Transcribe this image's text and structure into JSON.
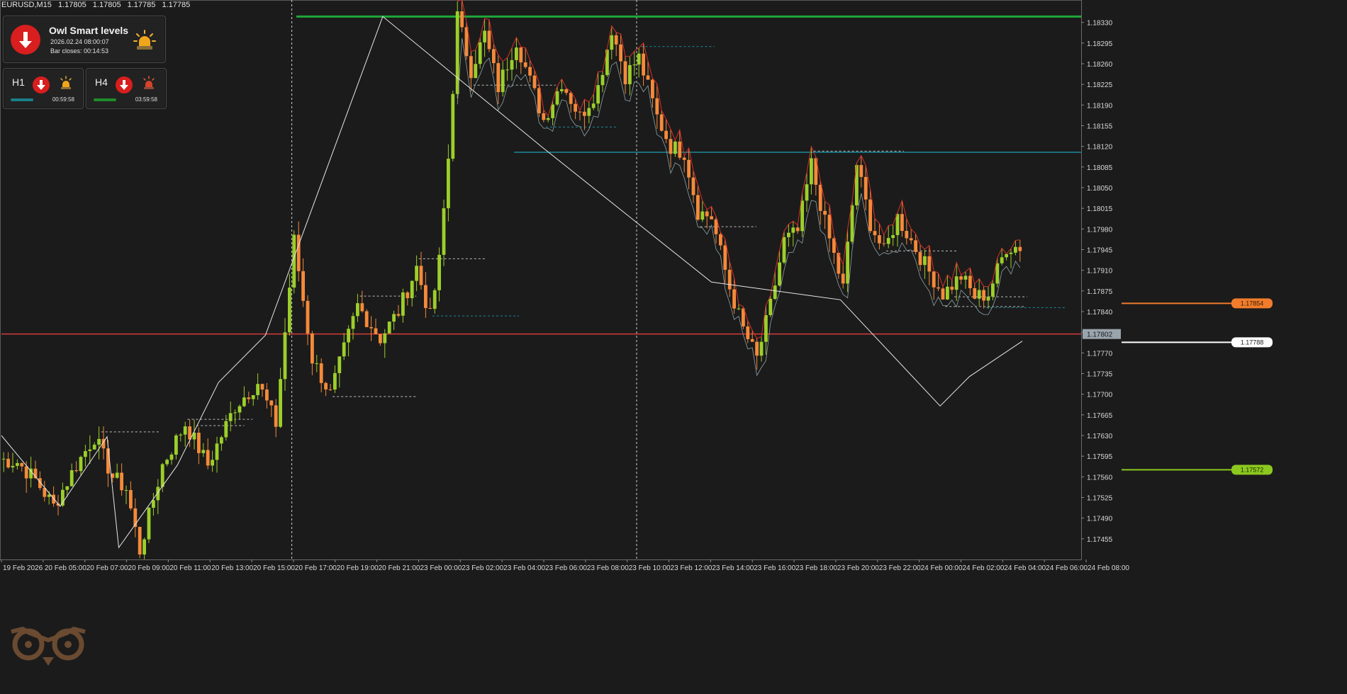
{
  "header": {
    "symbol": "EURUSD,M15",
    "open": "1.17805",
    "high": "1.17805",
    "low": "1.17785",
    "close": "1.17785"
  },
  "panel_main": {
    "title": "Owl Smart levels",
    "timestamp": "2026.02.24 08:00:07",
    "bar_close": "Bar closes: 00:14:53",
    "direction_icon": "arrow-down-icon",
    "alert_icon": "siren-icon"
  },
  "panel_h1": {
    "timeframe": "H1",
    "time": "00:59:58",
    "bar_color": "#1a7e86",
    "direction_icon": "arrow-down-icon"
  },
  "panel_h4": {
    "timeframe": "H4",
    "time": "03:59:58",
    "bar_color": "#1f8c2a",
    "direction_icon": "arrow-down-icon"
  },
  "colors": {
    "background": "#1b1b1b",
    "bull": "#9ccf2a",
    "bear": "#f58a3a",
    "red_line": "#d83a3a",
    "green_level": "#1ea83a",
    "teal_level": "#1a8a9a",
    "orange_tag": "#f07c2c",
    "white_tag": "#ffffff",
    "green_tag": "#8cc81f",
    "current_tag": "#9aa4ad"
  },
  "chart_data": {
    "type": "candlestick",
    "ylim": [
      1.1742,
      1.18368
    ],
    "y_ticks": [
      "1.18330",
      "1.18295",
      "1.18260",
      "1.18225",
      "1.18190",
      "1.18155",
      "1.18120",
      "1.18085",
      "1.18050",
      "1.18015",
      "1.17980",
      "1.17945",
      "1.17910",
      "1.17875",
      "1.17840",
      "1.17805",
      "1.17770",
      "1.17735",
      "1.17700",
      "1.17665",
      "1.17630",
      "1.17595",
      "1.17560",
      "1.17525",
      "1.17490",
      "1.17455"
    ],
    "x_labels": [
      "19 Feb 2026",
      "20 Feb 05:00",
      "20 Feb 07:00",
      "20 Feb 09:00",
      "20 Feb 11:00",
      "20 Feb 13:00",
      "20 Feb 15:00",
      "20 Feb 17:00",
      "20 Feb 19:00",
      "20 Feb 21:00",
      "23 Feb 00:00",
      "23 Feb 02:00",
      "23 Feb 04:00",
      "23 Feb 06:00",
      "23 Feb 08:00",
      "23 Feb 10:00",
      "23 Feb 12:00",
      "23 Feb 14:00",
      "23 Feb 16:00",
      "23 Feb 18:00",
      "23 Feb 20:00",
      "23 Feb 22:00",
      "24 Feb 00:00",
      "24 Feb 02:00",
      "24 Feb 04:00",
      "24 Feb 06:00",
      "24 Feb 08:00"
    ],
    "bar_count": 225,
    "anchors": [
      [
        0,
        1.1759
      ],
      [
        4,
        1.17585
      ],
      [
        8,
        1.17555
      ],
      [
        12,
        1.1751
      ],
      [
        17,
        1.1758
      ],
      [
        21,
        1.17628
      ],
      [
        25,
        1.1756
      ],
      [
        28,
        1.1754
      ],
      [
        31,
        1.17435
      ],
      [
        36,
        1.1758
      ],
      [
        41,
        1.1765
      ],
      [
        46,
        1.1758
      ],
      [
        52,
        1.1768
      ],
      [
        57,
        1.1772
      ],
      [
        61,
        1.1765
      ],
      [
        65,
        1.1796
      ],
      [
        69,
        1.1776
      ],
      [
        73,
        1.177
      ],
      [
        79,
        1.1785
      ],
      [
        84,
        1.17795
      ],
      [
        88,
        1.1784
      ],
      [
        92,
        1.17915
      ],
      [
        95,
        1.1783
      ],
      [
        97,
        1.17925
      ],
      [
        99,
        1.181
      ],
      [
        101,
        1.1834
      ],
      [
        104,
        1.1825
      ],
      [
        107,
        1.1831
      ],
      [
        110,
        1.1822
      ],
      [
        114,
        1.183
      ],
      [
        117,
        1.1823
      ],
      [
        120,
        1.18165
      ],
      [
        124,
        1.1823
      ],
      [
        128,
        1.1817
      ],
      [
        132,
        1.1822
      ],
      [
        135,
        1.1832
      ],
      [
        138,
        1.1824
      ],
      [
        141,
        1.1827
      ],
      [
        145,
        1.1817
      ],
      [
        148,
        1.1812
      ],
      [
        151,
        1.1811
      ],
      [
        154,
        1.1801
      ],
      [
        157,
        1.18
      ],
      [
        161,
        1.1788
      ],
      [
        164,
        1.1781
      ],
      [
        167,
        1.1776
      ],
      [
        170,
        1.1785
      ],
      [
        173,
        1.1796
      ],
      [
        176,
        1.17975
      ],
      [
        179,
        1.1809
      ],
      [
        182,
        1.1799
      ],
      [
        186,
        1.1788
      ],
      [
        189,
        1.1809
      ],
      [
        192,
        1.1799
      ],
      [
        195,
        1.1794
      ],
      [
        198,
        1.18
      ],
      [
        201,
        1.1796
      ],
      [
        204,
        1.1792
      ],
      [
        208,
        1.1787
      ],
      [
        212,
        1.179
      ],
      [
        215,
        1.17865
      ],
      [
        218,
        1.1787
      ],
      [
        222,
        1.1795
      ],
      [
        225,
        1.1795
      ],
      [
        228,
        1.1797
      ],
      [
        231,
        1.1788
      ],
      [
        234,
        1.1772
      ],
      [
        237,
        1.1782
      ],
      [
        240,
        1.1783
      ],
      [
        243,
        1.1785
      ],
      [
        246,
        1.1781
      ],
      [
        250,
        1.1769
      ],
      [
        254,
        1.177
      ],
      [
        256,
        1.1778
      ],
      [
        258,
        1.1781
      ],
      [
        260,
        1.1779
      ]
    ],
    "swing_line": [
      [
        0,
        1.1763
      ],
      [
        10,
        1.1751
      ],
      [
        18,
        1.17628
      ],
      [
        20,
        1.1744
      ],
      [
        30,
        1.1758
      ],
      [
        37,
        1.1772
      ],
      [
        45,
        1.178
      ],
      [
        65,
        1.1834
      ],
      [
        92,
        1.1812
      ],
      [
        121,
        1.1789
      ],
      [
        143,
        1.1786
      ],
      [
        160,
        1.1768
      ],
      [
        165,
        1.1773
      ],
      [
        174,
        1.1779
      ]
    ],
    "reference_levels": [
      {
        "price": 1.1834,
        "from_bar": 65,
        "color": "green_level",
        "style": "solid"
      },
      {
        "price": 1.1811,
        "from_bar": 113,
        "color": "teal_level",
        "style": "solid"
      },
      {
        "price": 1.17802,
        "from_bar": 0,
        "color": "red_line",
        "style": "solid"
      }
    ],
    "time_separators": [
      64,
      140
    ],
    "price_tags": [
      {
        "price": 1.17854,
        "label": "1.17854",
        "color": "orange_tag",
        "text_color": "#3a1a00"
      },
      {
        "price": 1.17788,
        "label": "1.17788",
        "color": "white_tag",
        "text_color": "#222222"
      },
      {
        "price": 1.17572,
        "label": "1.17572",
        "color": "green_tag",
        "text_color": "#1a2a00"
      }
    ],
    "current_price": {
      "price": 1.17802,
      "label": "1.17802"
    }
  }
}
